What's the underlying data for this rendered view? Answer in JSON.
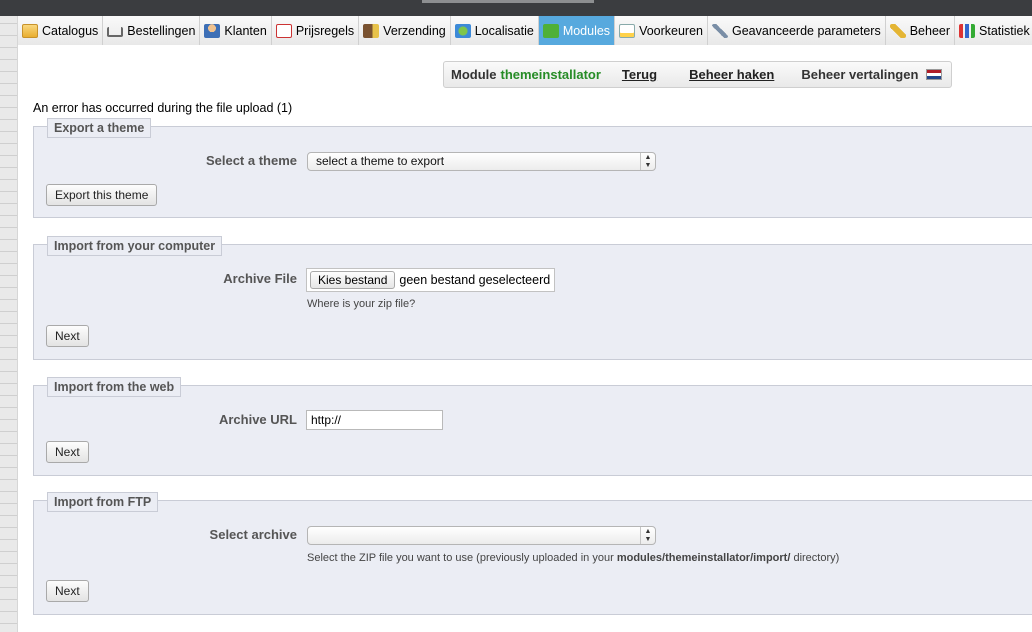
{
  "tabs": [
    {
      "label": "Catalogus",
      "icon": "folder-icon",
      "active": false
    },
    {
      "label": "Bestellingen",
      "icon": "cart-icon",
      "active": false
    },
    {
      "label": "Klanten",
      "icon": "user-icon",
      "active": false
    },
    {
      "label": "Prijsregels",
      "icon": "price-tag-icon",
      "active": false
    },
    {
      "label": "Verzending",
      "icon": "truck-icon",
      "active": false
    },
    {
      "label": "Localisatie",
      "icon": "globe-icon",
      "active": false
    },
    {
      "label": "Modules",
      "icon": "puzzle-icon",
      "active": true
    },
    {
      "label": "Voorkeuren",
      "icon": "preferences-icon",
      "active": false
    },
    {
      "label": "Geavanceerde parameters",
      "icon": "wrench-icon",
      "active": false
    },
    {
      "label": "Beheer",
      "icon": "key-icon",
      "active": false
    },
    {
      "label": "Statistiek",
      "icon": "chart-icon",
      "active": false
    }
  ],
  "module_bar": {
    "label": "Module",
    "name": "themeinstallator",
    "back_link": "Terug",
    "hooks_link": "Beheer haken",
    "translations_link": "Beheer vertalingen",
    "flag_icon": "dutch-flag-icon"
  },
  "error_message": "An error has occurred during the file upload (1)",
  "export_section": {
    "legend": "Export a theme",
    "select_label": "Select a theme",
    "select_value": "select a theme to export",
    "button": "Export this theme"
  },
  "import_computer": {
    "legend": "Import from your computer",
    "field_label": "Archive File",
    "file_button": "Kies bestand",
    "file_status": "geen bestand geselecteerd",
    "hint": "Where is your zip file?",
    "button": "Next"
  },
  "import_web": {
    "legend": "Import from the web",
    "field_label": "Archive URL",
    "url_value": "http://",
    "button": "Next"
  },
  "import_ftp": {
    "legend": "Import from FTP",
    "field_label": "Select archive",
    "select_value": "",
    "hint_before": "Select the ZIP file you want to use (previously uploaded in your ",
    "hint_path": "modules/themeinstallator/import/",
    "hint_after": " directory)",
    "button": "Next"
  },
  "colors": {
    "active_tab": "#57a9de",
    "module_name": "#268c26",
    "section_bg": "#ebedf4"
  }
}
